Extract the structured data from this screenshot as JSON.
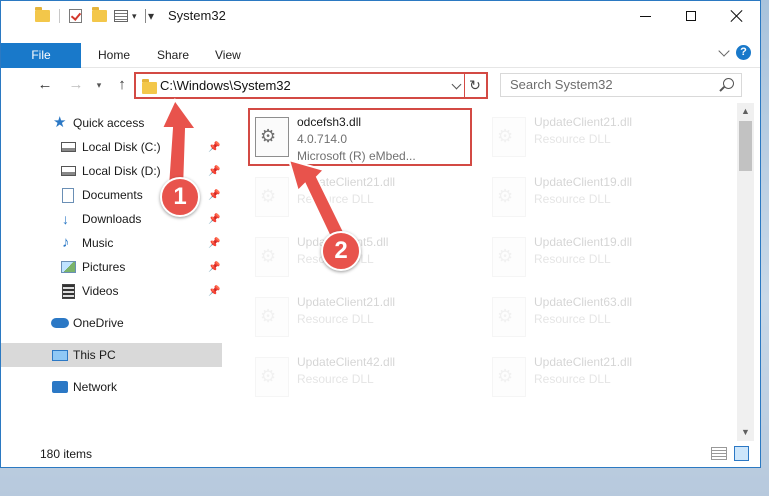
{
  "window": {
    "title": "System32"
  },
  "ribbon": {
    "tabs": [
      "File",
      "Home",
      "Share",
      "View"
    ]
  },
  "navigation": {
    "address": "C:\\Windows\\System32",
    "search_placeholder": "Search System32"
  },
  "sidebar": {
    "items": [
      {
        "label": "Quick access",
        "icon": "star-icon"
      },
      {
        "label": "Local Disk (C:)",
        "icon": "drive-icon",
        "pinned": true
      },
      {
        "label": "Local Disk (D:)",
        "icon": "drive-icon",
        "pinned": true
      },
      {
        "label": "Documents",
        "icon": "documents-icon",
        "pinned": true
      },
      {
        "label": "Downloads",
        "icon": "downloads-icon",
        "pinned": true
      },
      {
        "label": "Music",
        "icon": "music-icon",
        "pinned": true
      },
      {
        "label": "Pictures",
        "icon": "pictures-icon",
        "pinned": true
      },
      {
        "label": "Videos",
        "icon": "videos-icon",
        "pinned": true
      },
      {
        "label": "OneDrive",
        "icon": "onedrive-icon"
      },
      {
        "label": "This PC",
        "icon": "pc-icon",
        "selected": true
      },
      {
        "label": "Network",
        "icon": "network-icon"
      }
    ]
  },
  "files": {
    "featured": {
      "name": "odcefsh3.dll",
      "version": "4.0.714.0",
      "company": "Microsoft (R) eMbed..."
    },
    "items": [
      {
        "name": "UpdateClient21.dll",
        "type": "Resource DLL"
      },
      {
        "name": "UpdateClient21.dll",
        "type": "Resource DLL"
      },
      {
        "name": "UpdateClient19.dll",
        "type": "Resource DLL"
      },
      {
        "name": "UpdateClient5.dll",
        "type": "Resource DLL"
      },
      {
        "name": "UpdateClient19.dll",
        "type": "Resource DLL"
      },
      {
        "name": "UpdateClient21.dll",
        "type": "Resource DLL"
      },
      {
        "name": "UpdateClient63.dll",
        "type": "Resource DLL"
      },
      {
        "name": "UpdateClient42.dll",
        "type": "Resource DLL"
      },
      {
        "name": "UpdateClient21.dll",
        "type": "Resource DLL"
      }
    ]
  },
  "status": {
    "item_count": "180 items"
  },
  "callouts": {
    "step1": "1",
    "step2": "2"
  },
  "colors": {
    "accent": "#1979ca",
    "highlight": "#d34a44",
    "callout": "#e8534c"
  }
}
